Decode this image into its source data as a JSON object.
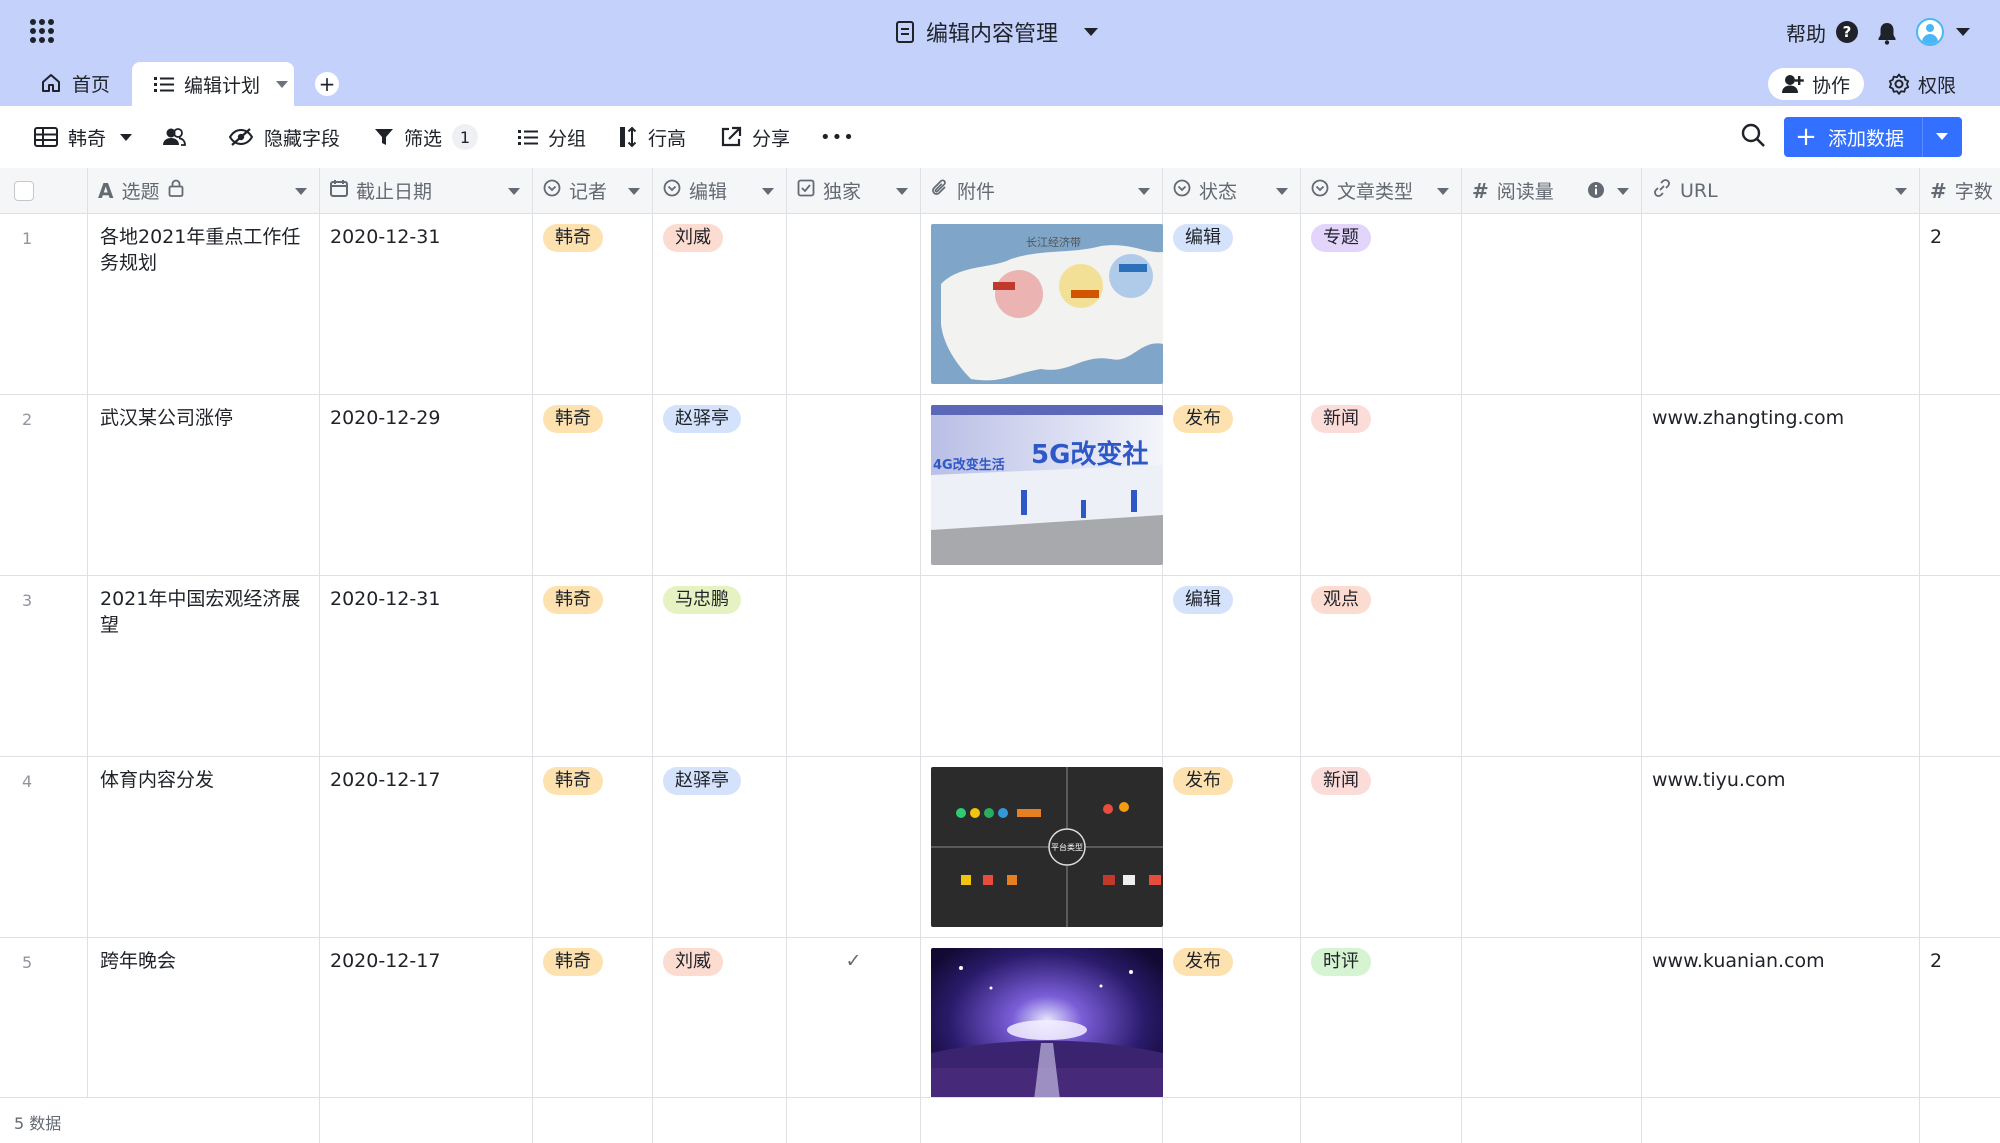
{
  "header": {
    "doc_title": "编辑内容管理",
    "help_label": "帮助",
    "help_q": "?"
  },
  "tabs": [
    {
      "label": "首页"
    },
    {
      "label": "编辑计划"
    }
  ],
  "tab_add": "+",
  "collab_label": "协作",
  "permission_label": "权限",
  "toolbar": {
    "view_label": "韩奇",
    "hide_fields_label": "隐藏字段",
    "filter_label": "筛选",
    "filter_count": "1",
    "group_label": "分组",
    "row_height_label": "行高",
    "share_label": "分享",
    "more_label": "•••",
    "add_data_label": "添加数据"
  },
  "columns": [
    {
      "label": "选题",
      "icon": "text-field-icon"
    },
    {
      "label": "截止日期",
      "icon": "calendar-icon"
    },
    {
      "label": "记者",
      "icon": "single-select-icon"
    },
    {
      "label": "编辑",
      "icon": "single-select-icon"
    },
    {
      "label": "独家",
      "icon": "checkbox-icon"
    },
    {
      "label": "附件",
      "icon": "attachment-icon"
    },
    {
      "label": "状态",
      "icon": "single-select-icon"
    },
    {
      "label": "文章类型",
      "icon": "single-select-icon"
    },
    {
      "label": "阅读量",
      "icon": "number-icon"
    },
    {
      "label": "URL",
      "icon": "link-icon"
    },
    {
      "label": "字数",
      "icon": "number-icon"
    }
  ],
  "rows": [
    {
      "num": "1",
      "title": "各地2021年重点工作任务规划",
      "date": "2020-12-31",
      "reporter": "韩奇",
      "editor": "刘威",
      "exclusive": "",
      "attachment": "map",
      "status": "编辑",
      "type": "专题",
      "url": "",
      "word_count": "2"
    },
    {
      "num": "2",
      "title": "武汉某公司涨停",
      "date": "2020-12-29",
      "reporter": "韩奇",
      "editor": "赵驿亭",
      "exclusive": "",
      "attachment": "5g",
      "status": "发布",
      "type": "新闻",
      "url": "www.zhangting.com",
      "word_count": ""
    },
    {
      "num": "3",
      "title": "2021年中国宏观经济展望",
      "date": "2020-12-31",
      "reporter": "韩奇",
      "editor": "马忠鹏",
      "exclusive": "",
      "attachment": "",
      "status": "编辑",
      "type": "观点",
      "url": "",
      "word_count": ""
    },
    {
      "num": "4",
      "title": "体育内容分发",
      "date": "2020-12-17",
      "reporter": "韩奇",
      "editor": "赵驿亭",
      "exclusive": "",
      "attachment": "platform",
      "status": "发布",
      "type": "新闻",
      "url": "www.tiyu.com",
      "word_count": ""
    },
    {
      "num": "5",
      "title": "跨年晚会",
      "date": "2020-12-17",
      "reporter": "韩奇",
      "editor": "刘威",
      "exclusive": "✓",
      "attachment": "concert",
      "status": "发布",
      "type": "时评",
      "url": "www.kuanian.com",
      "word_count": "2"
    }
  ],
  "attachment_text": {
    "map_label": "长江经济带",
    "banner_small": "4G改变生活",
    "banner_big": "5G改变社",
    "platform_center": "平台类型"
  },
  "footer_label": "5 数据",
  "colors": {
    "topbar_bg": "#c3d1fb",
    "primary": "#3370ff",
    "tag_reporter": "#fde2b0",
    "tag_editor_liuwei": "#fcdcd0",
    "tag_editor_zhao": "#d4e2fb",
    "tag_editor_ma": "#e6f2c2",
    "tag_status_edit": "#d4e2fb",
    "tag_status_publish": "#fde2b0",
    "tag_type_topic": "#e3d4fb",
    "tag_type_news": "#fcdcd8",
    "tag_type_opinion": "#fcdcd0",
    "tag_type_comment": "#d6f3d2"
  }
}
